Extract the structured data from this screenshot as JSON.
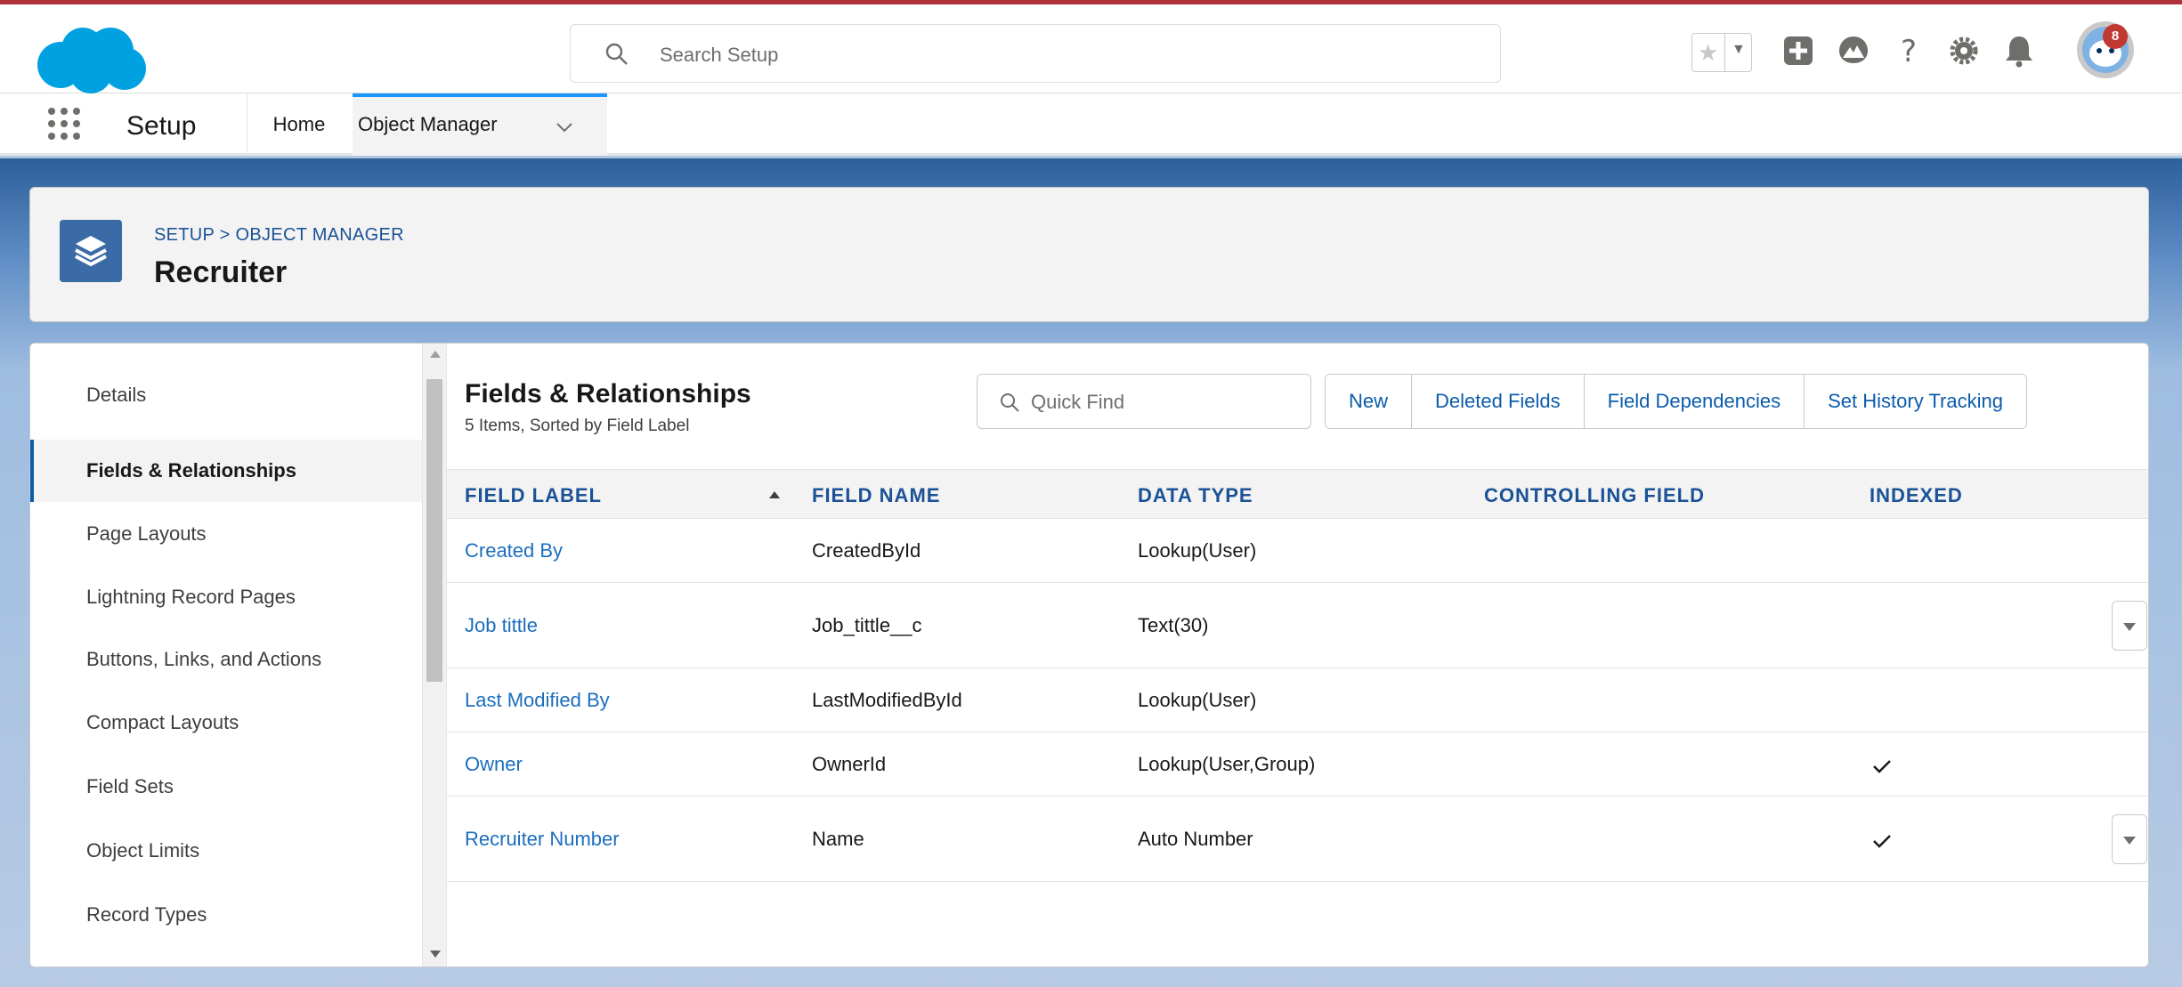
{
  "header": {
    "search_placeholder": "Search Setup",
    "notification_count": "8"
  },
  "context_bar": {
    "app_name": "Setup",
    "tabs": [
      {
        "label": "Home"
      },
      {
        "label": "Object Manager"
      }
    ]
  },
  "object_header": {
    "breadcrumb": "SETUP > OBJECT MANAGER",
    "title": "Recruiter"
  },
  "sidebar": {
    "items": [
      {
        "label": "Details"
      },
      {
        "label": "Fields & Relationships"
      },
      {
        "label": "Page Layouts"
      },
      {
        "label": "Lightning Record Pages"
      },
      {
        "label": "Buttons, Links, and Actions"
      },
      {
        "label": "Compact Layouts"
      },
      {
        "label": "Field Sets"
      },
      {
        "label": "Object Limits"
      },
      {
        "label": "Record Types"
      }
    ],
    "active_index": 1
  },
  "section": {
    "title": "Fields & Relationships",
    "subtitle": "5 Items, Sorted by Field Label",
    "quick_find_placeholder": "Quick Find",
    "buttons": [
      "New",
      "Deleted Fields",
      "Field Dependencies",
      "Set History Tracking"
    ]
  },
  "table": {
    "columns": [
      "FIELD LABEL",
      "FIELD NAME",
      "DATA TYPE",
      "CONTROLLING FIELD",
      "INDEXED"
    ],
    "sorted_by": "FIELD LABEL",
    "rows": [
      {
        "label": "Created By",
        "name": "CreatedById",
        "type": "Lookup(User)",
        "controlling": "",
        "indexed": false,
        "has_menu": false
      },
      {
        "label": "Job tittle",
        "name": "Job_tittle__c",
        "type": "Text(30)",
        "controlling": "",
        "indexed": false,
        "has_menu": true
      },
      {
        "label": "Last Modified By",
        "name": "LastModifiedById",
        "type": "Lookup(User)",
        "controlling": "",
        "indexed": false,
        "has_menu": false
      },
      {
        "label": "Owner",
        "name": "OwnerId",
        "type": "Lookup(User,Group)",
        "controlling": "",
        "indexed": true,
        "has_menu": false
      },
      {
        "label": "Recruiter Number",
        "name": "Name",
        "type": "Auto Number",
        "controlling": "",
        "indexed": true,
        "has_menu": true
      }
    ]
  },
  "colors": {
    "brand_blue": "#1b96ff",
    "link_blue": "#1b6ebd",
    "notification_red": "#c23934",
    "object_icon_blue": "#3b6ba6",
    "cloud_logo": "#00a1e0"
  }
}
